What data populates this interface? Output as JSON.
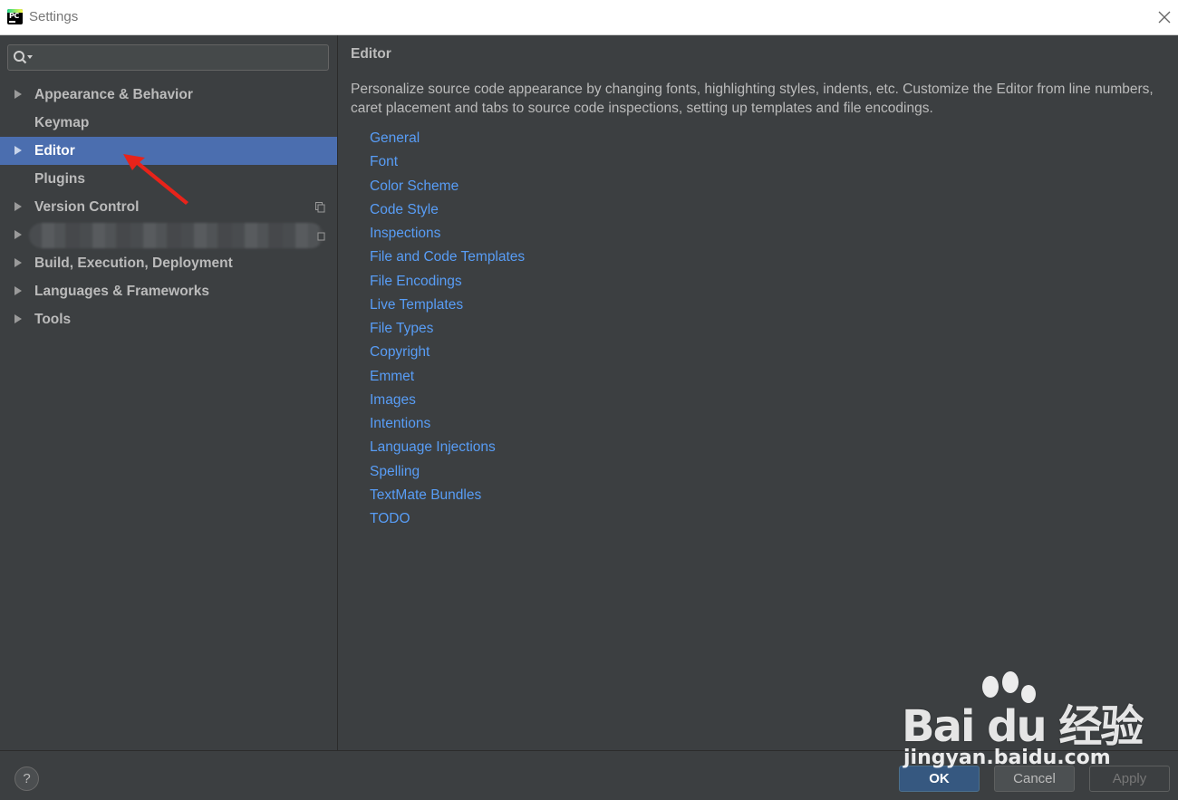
{
  "window": {
    "title": "Settings"
  },
  "sidebar": {
    "search_value": "",
    "items": [
      {
        "label": "Appearance & Behavior",
        "expandable": true
      },
      {
        "label": "Keymap",
        "expandable": false
      },
      {
        "label": "Editor",
        "expandable": true,
        "selected": true
      },
      {
        "label": "Plugins",
        "expandable": false
      },
      {
        "label": "Version Control",
        "expandable": true
      },
      {
        "label": "",
        "expandable": true,
        "redacted": true
      },
      {
        "label": "Build, Execution, Deployment",
        "expandable": true
      },
      {
        "label": "Languages & Frameworks",
        "expandable": true
      },
      {
        "label": "Tools",
        "expandable": true
      }
    ]
  },
  "main": {
    "title": "Editor",
    "description": "Personalize source code appearance by changing fonts, highlighting styles, indents, etc. Customize the Editor from line numbers, caret placement and tabs to source code inspections, setting up templates and file encodings.",
    "links": [
      "General",
      "Font",
      "Color Scheme",
      "Code Style",
      "Inspections",
      "File and Code Templates",
      "File Encodings",
      "Live Templates",
      "File Types",
      "Copyright",
      "Emmet",
      "Images",
      "Intentions",
      "Language Injections",
      "Spelling",
      "TextMate Bundles",
      "TODO"
    ]
  },
  "footer": {
    "help_label": "?",
    "ok_label": "OK",
    "cancel_label": "Cancel",
    "apply_label": "Apply"
  },
  "app_icon": {
    "text": "PC"
  },
  "watermark": {
    "brand": "Bai du 经验",
    "url": "jingyan.baidu.com"
  },
  "colors": {
    "background": "#3c3f41",
    "selection": "#4b6eaf",
    "link": "#589df6",
    "text": "#bbbbbb",
    "annotation_arrow": "#e8231a"
  }
}
